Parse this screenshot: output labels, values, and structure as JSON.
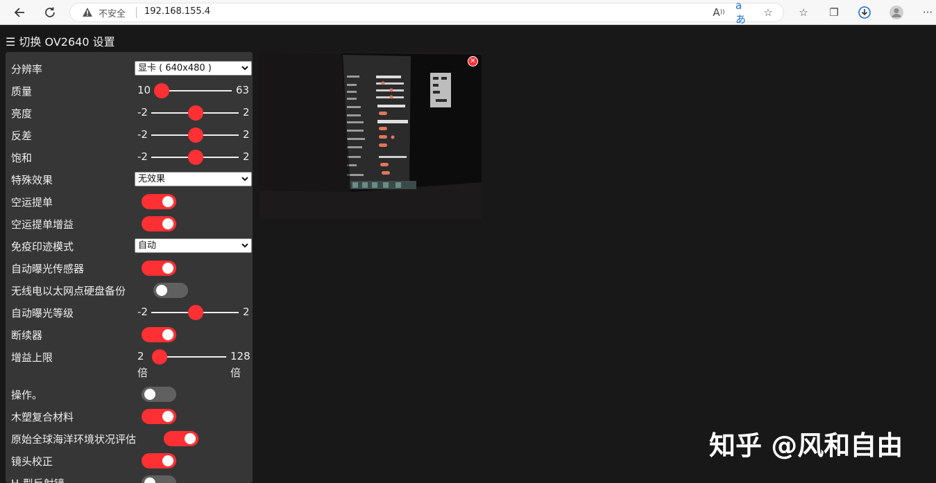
{
  "browser": {
    "security_label": "不安全",
    "url": "192.168.155.4"
  },
  "header": {
    "menu_icon": "hamburger-icon",
    "title": "☰ 切换 OV2640 设置"
  },
  "settings": {
    "resolution": {
      "label": "分辨率",
      "value": "显卡 ( 640x480 )"
    },
    "quality": {
      "label": "质量",
      "min": "10",
      "max": "63",
      "value": 10
    },
    "brightness": {
      "label": "亮度",
      "min": "-2",
      "max": "2",
      "value": 0
    },
    "contrast": {
      "label": "反差",
      "min": "-2",
      "max": "2",
      "value": 0
    },
    "saturation": {
      "label": "饱和",
      "min": "-2",
      "max": "2",
      "value": 0
    },
    "special_effect": {
      "label": "特殊效果",
      "value": "无效果"
    },
    "awb": {
      "label": "空运提单",
      "on": true
    },
    "awb_gain": {
      "label": "空运提单增益",
      "on": true
    },
    "wb_mode": {
      "label": "免疫印迹模式",
      "value": "自动"
    },
    "aec_sensor": {
      "label": "自动曝光传感器",
      "on": true
    },
    "aec_dsp": {
      "label": "无线电以太网点硬盘备份",
      "on": false
    },
    "ae_level": {
      "label": "自动曝光等级",
      "min": "-2",
      "max": "2",
      "value": 0
    },
    "agc": {
      "label": "断续器",
      "on": true
    },
    "gain_ceiling": {
      "label": "增益上限",
      "min_num": "2",
      "min_unit": "倍",
      "max_num": "128",
      "max_unit": "倍",
      "value": 2
    },
    "bpc": {
      "label": "操作。",
      "on": false
    },
    "wpc": {
      "label": "木塑复合材料",
      "on": true
    },
    "raw_gma": {
      "label": "原始全球海洋环境状况评估",
      "on": true
    },
    "lens_correction": {
      "label": "镜头校正",
      "on": true
    },
    "hmirror": {
      "label": "H-型反射镜"
    }
  },
  "watermark": "知乎 @风和自由",
  "colors": {
    "accent": "#ff3034",
    "panel": "#363636",
    "background": "#181818"
  }
}
